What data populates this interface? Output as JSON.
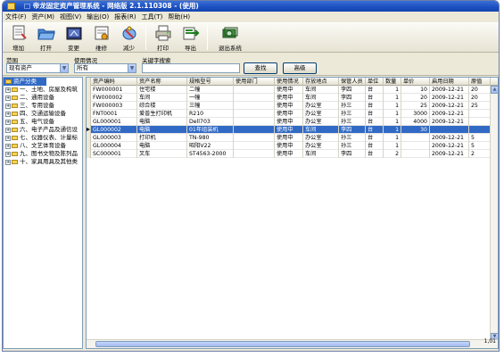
{
  "window": {
    "title": "□ 帝龙固定资产管理系统 - 网络版 2.1.110308 - (使用)"
  },
  "menu": [
    "文件(F)",
    "资产(M)",
    "视图(V)",
    "输出(O)",
    "报表(R)",
    "工具(T)",
    "帮助(H)"
  ],
  "toolbar": [
    {
      "label": "增加",
      "icon": "add-document-icon"
    },
    {
      "label": "打开",
      "icon": "open-folder-icon"
    },
    {
      "label": "变更",
      "icon": "change-icon"
    },
    {
      "label": "维修",
      "icon": "repair-icon"
    },
    {
      "label": "减少",
      "icon": "reduce-icon"
    },
    {
      "label": "打印",
      "icon": "printer-icon"
    },
    {
      "label": "导出",
      "icon": "export-icon"
    },
    {
      "label": "退出系统",
      "icon": "exit-icon"
    }
  ],
  "filters": {
    "scope_label": "范围",
    "scope_value": "现有资产",
    "status_label": "使用情况",
    "status_value": "所有",
    "keyword_label": "关键字搜索",
    "keyword_value": "",
    "search_button": "查找",
    "advanced_button": "高级"
  },
  "tree": {
    "root": "资产分类",
    "nodes": [
      "一、土地、房屋及构筑",
      "二、通用设备",
      "三、专用设备",
      "四、交通运输设备",
      "五、电气设备",
      "六、电子产品及通信设",
      "七、仪器仪表、计量标",
      "八、文艺体育设备",
      "九、图书文物及陈列品",
      "十、家具用具及其他类"
    ]
  },
  "grid": {
    "columns": [
      "资产编码",
      "资产名称",
      "规格型号",
      "使用部门",
      "使用情况",
      "存放地点",
      "保管人员",
      "单位",
      "数量",
      "单价",
      "启用日期",
      "原值"
    ],
    "rows": [
      [
        "FW000001",
        "住宅楼",
        "二幢",
        "",
        "使用中",
        "车间",
        "李四",
        "台",
        "1",
        "10",
        "2009-12-21",
        "20"
      ],
      [
        "FW000002",
        "车间",
        "一幢",
        "",
        "使用中",
        "车间",
        "李四",
        "台",
        "1",
        "20",
        "2009-12-21",
        "20"
      ],
      [
        "FW000003",
        "综合楼",
        "三幢",
        "",
        "使用中",
        "办公室",
        "孙三",
        "台",
        "1",
        "25",
        "2009-12-21",
        "25"
      ],
      [
        "FNT0001",
        "爱普生打印机",
        "R210",
        "",
        "使用中",
        "办公室",
        "孙三",
        "台",
        "1",
        "3000",
        "2009-12-21",
        ""
      ],
      [
        "GL000001",
        "电脑",
        "Dell703",
        "",
        "使用中",
        "办公室",
        "孙三",
        "台",
        "1",
        "4000",
        "2009-12-21",
        ""
      ],
      [
        "GL000002",
        "电脑",
        "01年组装机",
        "",
        "使用中",
        "车间",
        "李四",
        "台",
        "1",
        "30",
        "",
        ""
      ],
      [
        "GL000003",
        "打印机",
        "TN-980",
        "",
        "使用中",
        "办公室",
        "孙三",
        "台",
        "1",
        "",
        "2009-12-21",
        "5"
      ],
      [
        "GL000004",
        "电脑",
        "昭阳V22",
        "",
        "使用中",
        "办公室",
        "孙三",
        "台",
        "1",
        "",
        "2009-12-21",
        "5"
      ],
      [
        "SC000001",
        "叉车",
        "ST4563-2000",
        "",
        "使用中",
        "车间",
        "李四",
        "台",
        "2",
        "",
        "2009-12-21",
        "2"
      ]
    ],
    "selected_row": 5,
    "footer": "1,01"
  }
}
